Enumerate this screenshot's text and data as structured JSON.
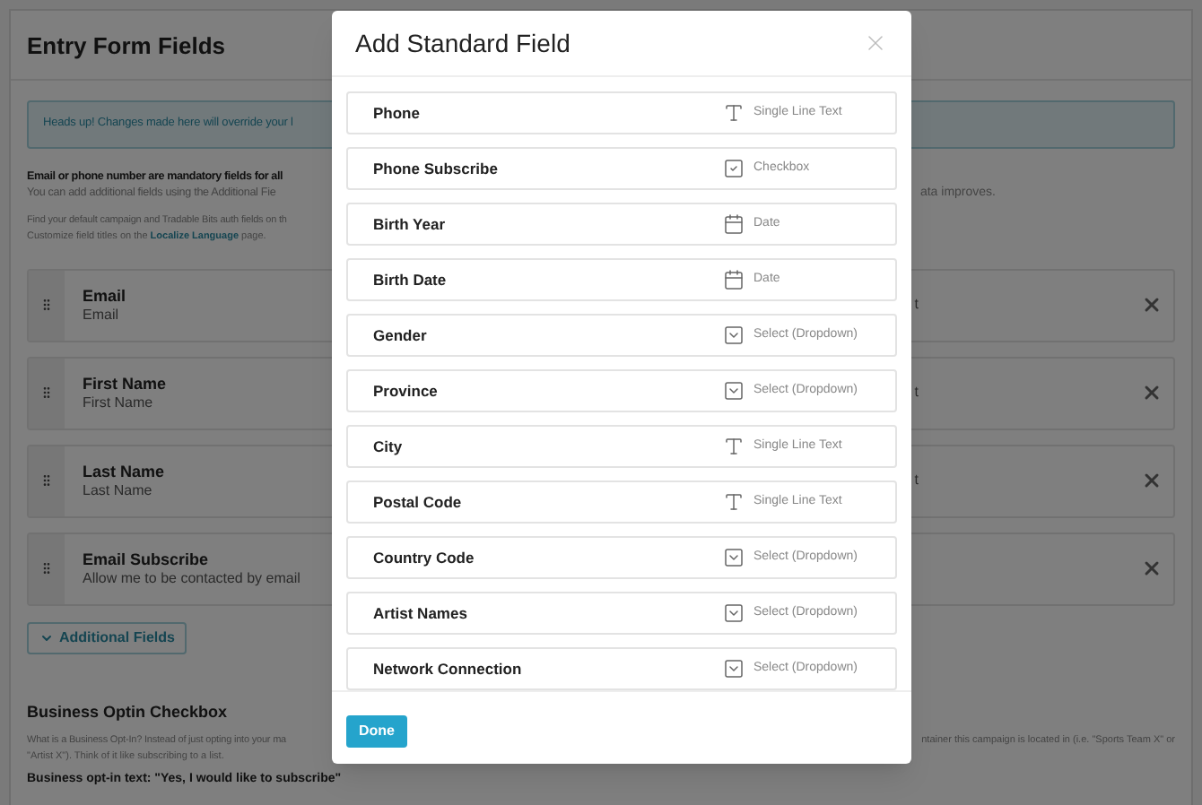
{
  "page": {
    "title": "Entry Form Fields",
    "alert": "Heads up! Changes made here will override your l",
    "notice_bold": "Email or phone number are mandatory fields for all",
    "notice_text": "You can add additional fields using the Additional Fie",
    "notice_text_right": "ata improves.",
    "help_line_1": "Find your default campaign and Tradable Bits auth fields on th",
    "help_line_2": {
      "before": "Customize field titles on the",
      "link": "Localize Language",
      "after": "page."
    },
    "fields": [
      {
        "label": "Email",
        "sublabel": "Email",
        "column_3": "t"
      },
      {
        "label": "First Name",
        "sublabel": "First Name",
        "column_3": "t"
      },
      {
        "label": "Last Name",
        "sublabel": "Last Name",
        "column_3": "t"
      },
      {
        "label": "Email Subscribe",
        "sublabel": "Allow me to be contacted by email"
      }
    ],
    "additional_button": "Additional Fields",
    "section": {
      "title": "Business Optin Checkbox",
      "line_1": "What is a Business Opt-In? Instead of just opting into your ma",
      "line_1_right": "ntainer this campaign is located in (i.e. \"Sports Team X\" or",
      "line_2": "\"Artist X\"). Think of it like subscribing to a list.",
      "line_3": "Business opt-in text: \"Yes, I would like to subscribe\""
    }
  },
  "modal": {
    "title": "Add Standard Field",
    "fields": [
      {
        "label": "Phone",
        "type": "Single Line Text",
        "kind": "text"
      },
      {
        "label": "Phone Subscribe",
        "type": "Checkbox",
        "kind": "checkbox"
      },
      {
        "label": "Birth Year",
        "type": "Date",
        "kind": "date"
      },
      {
        "label": "Birth Date",
        "type": "Date",
        "kind": "date"
      },
      {
        "label": "Gender",
        "type": "Select (Dropdown)",
        "kind": "select"
      },
      {
        "label": "Province",
        "type": "Select (Dropdown)",
        "kind": "select"
      },
      {
        "label": "City",
        "type": "Single Line Text",
        "kind": "text"
      },
      {
        "label": "Postal Code",
        "type": "Single Line Text",
        "kind": "text"
      },
      {
        "label": "Country Code",
        "type": "Select (Dropdown)",
        "kind": "select"
      },
      {
        "label": "Artist Names",
        "type": "Select (Dropdown)",
        "kind": "select"
      },
      {
        "label": "Network Connection",
        "type": "Select (Dropdown)",
        "kind": "select"
      }
    ],
    "done_button": "Done"
  }
}
